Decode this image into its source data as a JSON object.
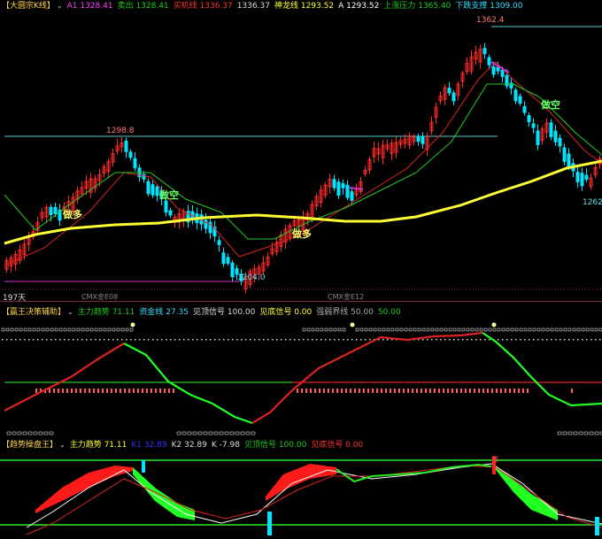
{
  "colors": {
    "up": "#ff2a2a",
    "down": "#00e5ff",
    "ma_yellow": "#ffff33",
    "ma_green": "#22cc22",
    "ma_red": "#dd2222",
    "level_cyan": "#50c8d0",
    "level_magenta": "#cc33cc",
    "dot_yellow": "#ffff99",
    "dot_red": "#ff6060",
    "axis_dotted": "#7a2a3a"
  },
  "pane1": {
    "title": "【大圆宗K线】",
    "indicators": [
      {
        "label": "A1 1328.41",
        "color": "#ff44ff"
      },
      {
        "label": "卖出 1328.41",
        "color": "#22cc22"
      },
      {
        "label": "买机线 1336.37",
        "color": "#ff3333"
      },
      {
        "label": "1336.37",
        "color": "#dddddd"
      },
      {
        "label": "神龙线 1293.52",
        "color": "#ffff33"
      },
      {
        "label": "A 1293.52",
        "color": "#ffffff"
      },
      {
        "label": "上涨压力 1365.40",
        "color": "#22cc22"
      },
      {
        "label": "下跌支撑 1309.00",
        "color": "#33ddff"
      }
    ],
    "price_labels": {
      "high": "1362.4",
      "mid_high": "1298.8",
      "low": "1204.0",
      "right_low": "1262"
    },
    "signals": {
      "do_long": "做多",
      "do_short": "做空"
    },
    "bottom_left": "197天",
    "markers": [
      "CMX金E08",
      "CMX金E12"
    ]
  },
  "pane2": {
    "title": "【赢王决策辅助】",
    "indicators": [
      {
        "label": "主力趋势 71.11",
        "color": "#22cc22"
      },
      {
        "label": "资金线 27.35",
        "color": "#33ddff"
      },
      {
        "label": "见顶信号 100.00",
        "color": "#dddddd"
      },
      {
        "label": "见底信号 0.00",
        "color": "#ffff33"
      },
      {
        "label": "强弱界线 50.00",
        "color": "#aaaaaa"
      },
      {
        "label": "50.00",
        "color": "#22cc22"
      }
    ]
  },
  "pane3": {
    "title": "【趋势操盘王】",
    "indicators": [
      {
        "label": "主力趋势 71.11",
        "color": "#ffff33"
      },
      {
        "label": "K1 32.89",
        "color": "#3333ff"
      },
      {
        "label": "K2 32.89",
        "color": "#dddddd"
      },
      {
        "label": "K -7.98",
        "color": "#dddddd"
      },
      {
        "label": "见顶信号 100.00",
        "color": "#22cc22"
      },
      {
        "label": "见底信号 0.00",
        "color": "#ff3333"
      }
    ],
    "top_mark": "顶"
  }
}
